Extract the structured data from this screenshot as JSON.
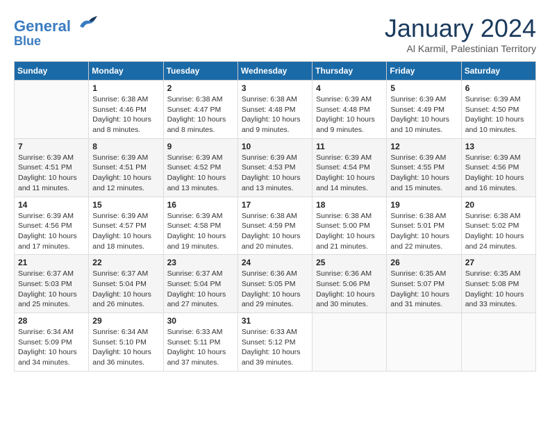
{
  "logo": {
    "line1": "General",
    "line2": "Blue"
  },
  "header": {
    "title": "January 2024",
    "subtitle": "Al Karmil, Palestinian Territory"
  },
  "days_of_week": [
    "Sunday",
    "Monday",
    "Tuesday",
    "Wednesday",
    "Thursday",
    "Friday",
    "Saturday"
  ],
  "weeks": [
    [
      {
        "num": "",
        "info": ""
      },
      {
        "num": "1",
        "info": "Sunrise: 6:38 AM\nSunset: 4:46 PM\nDaylight: 10 hours\nand 8 minutes."
      },
      {
        "num": "2",
        "info": "Sunrise: 6:38 AM\nSunset: 4:47 PM\nDaylight: 10 hours\nand 8 minutes."
      },
      {
        "num": "3",
        "info": "Sunrise: 6:38 AM\nSunset: 4:48 PM\nDaylight: 10 hours\nand 9 minutes."
      },
      {
        "num": "4",
        "info": "Sunrise: 6:39 AM\nSunset: 4:48 PM\nDaylight: 10 hours\nand 9 minutes."
      },
      {
        "num": "5",
        "info": "Sunrise: 6:39 AM\nSunset: 4:49 PM\nDaylight: 10 hours\nand 10 minutes."
      },
      {
        "num": "6",
        "info": "Sunrise: 6:39 AM\nSunset: 4:50 PM\nDaylight: 10 hours\nand 10 minutes."
      }
    ],
    [
      {
        "num": "7",
        "info": "Sunrise: 6:39 AM\nSunset: 4:51 PM\nDaylight: 10 hours\nand 11 minutes."
      },
      {
        "num": "8",
        "info": "Sunrise: 6:39 AM\nSunset: 4:51 PM\nDaylight: 10 hours\nand 12 minutes."
      },
      {
        "num": "9",
        "info": "Sunrise: 6:39 AM\nSunset: 4:52 PM\nDaylight: 10 hours\nand 13 minutes."
      },
      {
        "num": "10",
        "info": "Sunrise: 6:39 AM\nSunset: 4:53 PM\nDaylight: 10 hours\nand 13 minutes."
      },
      {
        "num": "11",
        "info": "Sunrise: 6:39 AM\nSunset: 4:54 PM\nDaylight: 10 hours\nand 14 minutes."
      },
      {
        "num": "12",
        "info": "Sunrise: 6:39 AM\nSunset: 4:55 PM\nDaylight: 10 hours\nand 15 minutes."
      },
      {
        "num": "13",
        "info": "Sunrise: 6:39 AM\nSunset: 4:56 PM\nDaylight: 10 hours\nand 16 minutes."
      }
    ],
    [
      {
        "num": "14",
        "info": "Sunrise: 6:39 AM\nSunset: 4:56 PM\nDaylight: 10 hours\nand 17 minutes."
      },
      {
        "num": "15",
        "info": "Sunrise: 6:39 AM\nSunset: 4:57 PM\nDaylight: 10 hours\nand 18 minutes."
      },
      {
        "num": "16",
        "info": "Sunrise: 6:39 AM\nSunset: 4:58 PM\nDaylight: 10 hours\nand 19 minutes."
      },
      {
        "num": "17",
        "info": "Sunrise: 6:38 AM\nSunset: 4:59 PM\nDaylight: 10 hours\nand 20 minutes."
      },
      {
        "num": "18",
        "info": "Sunrise: 6:38 AM\nSunset: 5:00 PM\nDaylight: 10 hours\nand 21 minutes."
      },
      {
        "num": "19",
        "info": "Sunrise: 6:38 AM\nSunset: 5:01 PM\nDaylight: 10 hours\nand 22 minutes."
      },
      {
        "num": "20",
        "info": "Sunrise: 6:38 AM\nSunset: 5:02 PM\nDaylight: 10 hours\nand 24 minutes."
      }
    ],
    [
      {
        "num": "21",
        "info": "Sunrise: 6:37 AM\nSunset: 5:03 PM\nDaylight: 10 hours\nand 25 minutes."
      },
      {
        "num": "22",
        "info": "Sunrise: 6:37 AM\nSunset: 5:04 PM\nDaylight: 10 hours\nand 26 minutes."
      },
      {
        "num": "23",
        "info": "Sunrise: 6:37 AM\nSunset: 5:04 PM\nDaylight: 10 hours\nand 27 minutes."
      },
      {
        "num": "24",
        "info": "Sunrise: 6:36 AM\nSunset: 5:05 PM\nDaylight: 10 hours\nand 29 minutes."
      },
      {
        "num": "25",
        "info": "Sunrise: 6:36 AM\nSunset: 5:06 PM\nDaylight: 10 hours\nand 30 minutes."
      },
      {
        "num": "26",
        "info": "Sunrise: 6:35 AM\nSunset: 5:07 PM\nDaylight: 10 hours\nand 31 minutes."
      },
      {
        "num": "27",
        "info": "Sunrise: 6:35 AM\nSunset: 5:08 PM\nDaylight: 10 hours\nand 33 minutes."
      }
    ],
    [
      {
        "num": "28",
        "info": "Sunrise: 6:34 AM\nSunset: 5:09 PM\nDaylight: 10 hours\nand 34 minutes."
      },
      {
        "num": "29",
        "info": "Sunrise: 6:34 AM\nSunset: 5:10 PM\nDaylight: 10 hours\nand 36 minutes."
      },
      {
        "num": "30",
        "info": "Sunrise: 6:33 AM\nSunset: 5:11 PM\nDaylight: 10 hours\nand 37 minutes."
      },
      {
        "num": "31",
        "info": "Sunrise: 6:33 AM\nSunset: 5:12 PM\nDaylight: 10 hours\nand 39 minutes."
      },
      {
        "num": "",
        "info": ""
      },
      {
        "num": "",
        "info": ""
      },
      {
        "num": "",
        "info": ""
      }
    ]
  ]
}
